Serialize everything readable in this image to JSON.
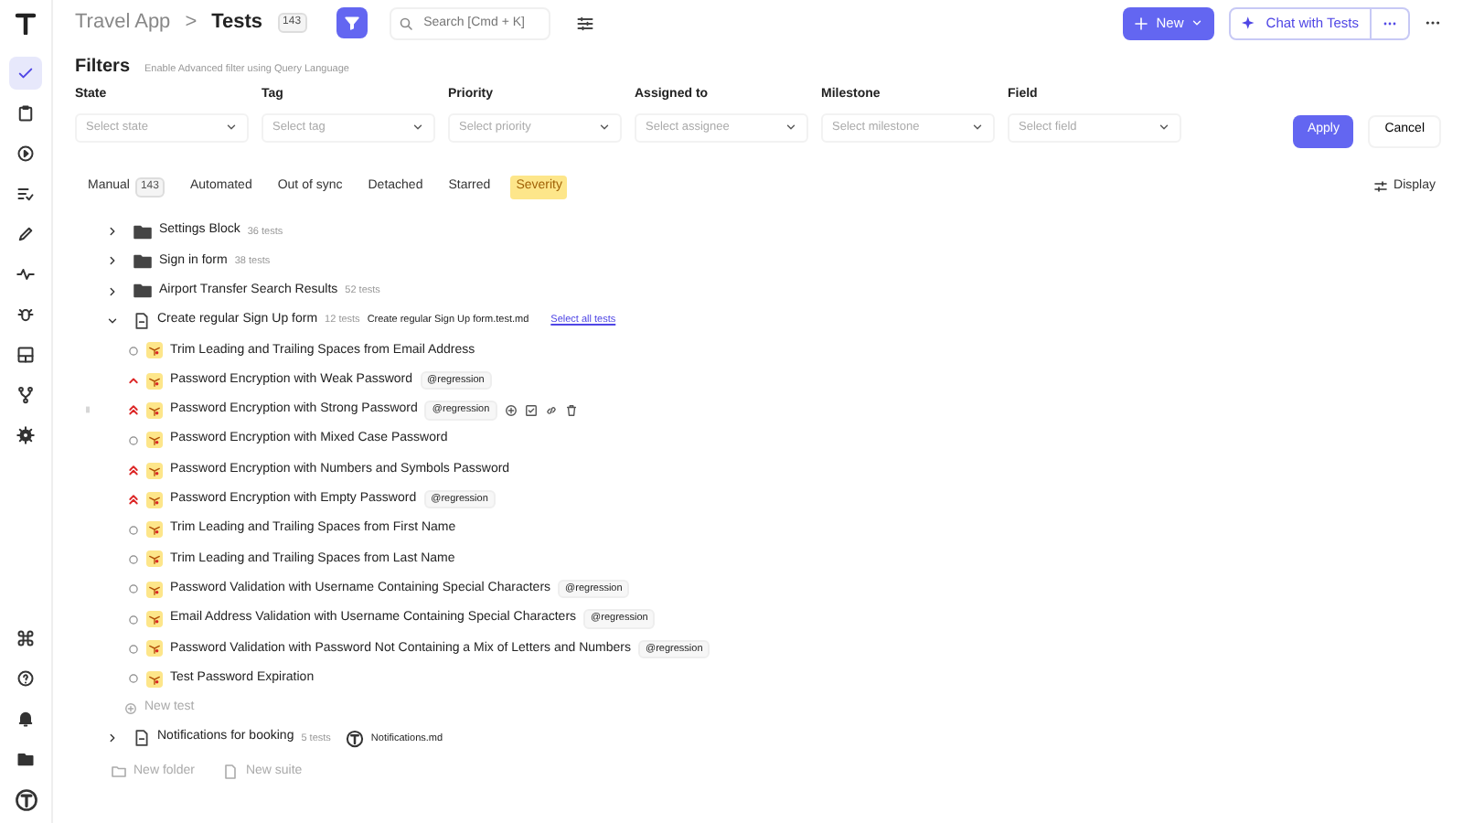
{
  "sidebar": {
    "items": [
      {
        "selected": true
      },
      {
        "selected": false
      },
      {
        "selected": false
      },
      {
        "selected": false
      },
      {
        "selected": false
      },
      {
        "selected": false
      },
      {
        "selected": false
      },
      {
        "selected": false
      },
      {
        "selected": false
      },
      {
        "selected": false
      }
    ]
  },
  "header": {
    "project": "Travel App",
    "separator": ">",
    "page": "Tests",
    "count": "143",
    "search_placeholder": "Search [Cmd + K]",
    "new_button": "New",
    "chat_button": "Chat with Tests"
  },
  "filters": {
    "title": "Filters",
    "hint_before": "Enable",
    "hint_link": "Advanced filter",
    "hint_after": "using Query Language",
    "fields": [
      {
        "label": "State",
        "placeholder": "Select state"
      },
      {
        "label": "Tag",
        "placeholder": "Select tag"
      },
      {
        "label": "Priority",
        "placeholder": "Select priority"
      },
      {
        "label": "Assigned to",
        "placeholder": "Select assignee"
      },
      {
        "label": "Milestone",
        "placeholder": "Select milestone"
      },
      {
        "label": "Field",
        "placeholder": "Select field"
      }
    ],
    "apply": "Apply",
    "cancel": "Cancel"
  },
  "tabs": [
    {
      "label": "Manual",
      "count": "143",
      "selected": false,
      "highlighted": false
    },
    {
      "label": "Automated",
      "selected": false,
      "highlighted": false
    },
    {
      "label": "Out of sync",
      "selected": false,
      "highlighted": false
    },
    {
      "label": "Detached",
      "selected": false,
      "highlighted": false
    },
    {
      "label": "Starred",
      "selected": false,
      "highlighted": false
    },
    {
      "label": "Severity",
      "selected": false,
      "highlighted": true
    }
  ],
  "display_button": "Display",
  "tree": [
    {
      "kind": "folder",
      "name": "Settings Block",
      "count": "36 tests",
      "expanded": false
    },
    {
      "kind": "folder",
      "name": "Sign in form",
      "count": "38 tests",
      "expanded": false
    },
    {
      "kind": "folder",
      "name": "Airport Transfer Search Results",
      "count": "52 tests",
      "expanded": false
    },
    {
      "kind": "suite",
      "name": "Create regular Sign Up form",
      "count": "12 tests",
      "file": "Create regular Sign Up form.test.md",
      "link": "Select all tests",
      "expanded": true,
      "children": [
        {
          "kind": "none",
          "title": "Trim Leading and Trailing Spaces from Email Address",
          "hovered": false
        },
        {
          "kind": "high",
          "title": "Password Encryption with Weak Password",
          "tag": "@regression",
          "hovered": false
        },
        {
          "kind": "critical",
          "title": "Password Encryption with Strong Password",
          "tag": "@regression",
          "hovered": true
        },
        {
          "kind": "none",
          "title": "Password Encryption with Mixed Case Password",
          "hovered": false
        },
        {
          "kind": "critical",
          "title": "Password Encryption with Numbers and Symbols Password",
          "hovered": false
        },
        {
          "kind": "critical",
          "title": "Password Encryption with Empty Password",
          "tag": "@regression",
          "hovered": false
        },
        {
          "kind": "none",
          "title": "Trim Leading and Trailing Spaces from First Name",
          "hovered": false
        },
        {
          "kind": "none",
          "title": "Trim Leading and Trailing Spaces from Last Name",
          "hovered": false
        },
        {
          "kind": "none",
          "title": "Password Validation with Username Containing Special Characters",
          "tag": "@regression",
          "hovered": false
        },
        {
          "kind": "none",
          "title": "Email Address Validation with Username Containing Special Characters",
          "tag": "@regression",
          "hovered": false
        },
        {
          "kind": "none",
          "title": "Password Validation with Password Not Containing a Mix of Letters and Numbers",
          "tag": "@regression",
          "hovered": false
        },
        {
          "kind": "none",
          "title": "Test Password Expiration",
          "hovered": false
        }
      ],
      "new_test": "New test"
    },
    {
      "kind": "suite",
      "name": "Notifications for booking",
      "count": "5 tests",
      "file": "Notifications.md",
      "owner_avatar": true,
      "expanded": false
    }
  ],
  "footer": {
    "new_folder": "New folder",
    "new_suite": "New suite"
  }
}
